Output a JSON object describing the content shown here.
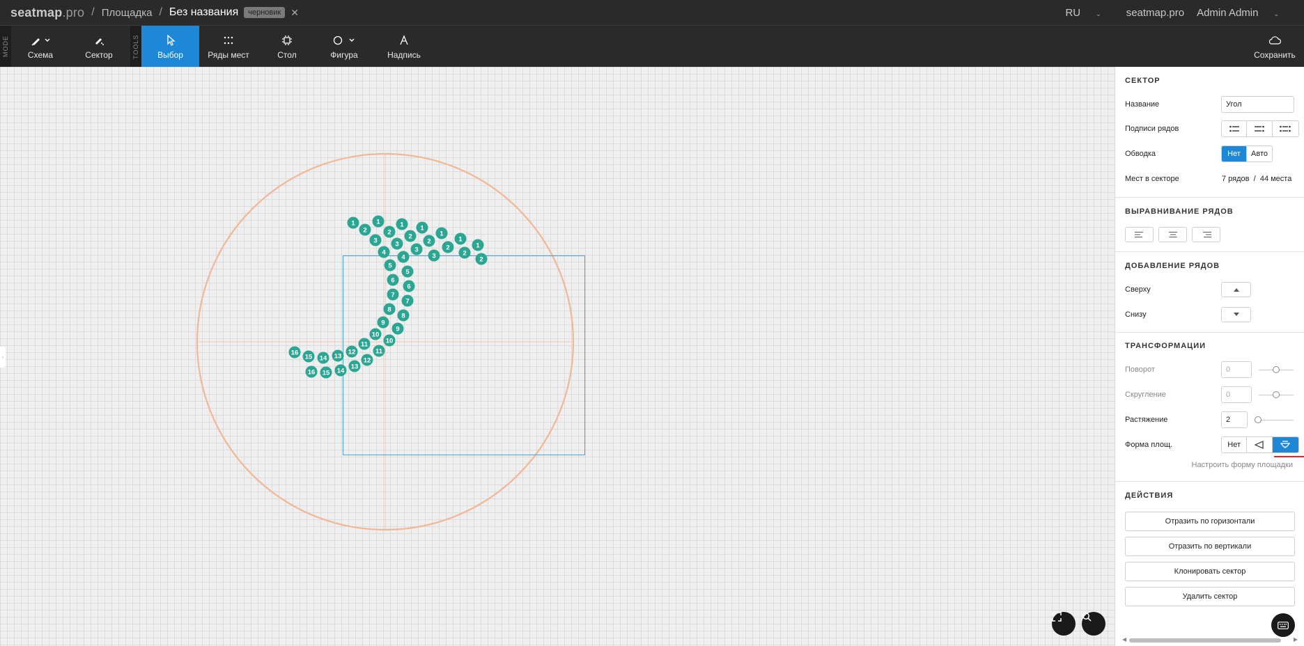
{
  "topbar": {
    "brand_main": "seatmap",
    "brand_suffix": ".pro",
    "breadcrumb": [
      "Площадка",
      "Без названия"
    ],
    "draft_badge": "черновик",
    "lang": "RU",
    "domain": "seatmap.pro",
    "user": "Admin Admin"
  },
  "toolbar": {
    "mode_label": "MODE",
    "tools_label": "TOOLS",
    "schema": "Схема",
    "sector": "Сектор",
    "select": "Выбор",
    "rows": "Ряды мест",
    "table": "Стол",
    "shape": "Фигура",
    "text": "Надпись",
    "save": "Сохранить"
  },
  "seat_map": {
    "seat_color": "#2aa693",
    "guide_color": "#f0b896",
    "selection_color": "#4aa3df",
    "rows": [
      [
        "1",
        "2",
        "3",
        "4",
        "5",
        "6",
        "7",
        "8",
        "9",
        "10",
        "11",
        "12",
        "13",
        "14",
        "15",
        "16"
      ],
      [
        "1",
        "2",
        "3",
        "4",
        "5",
        "6",
        "7",
        "8",
        "9",
        "10",
        "11",
        "12",
        "13",
        "14",
        "15",
        "16"
      ],
      [
        "1",
        "2",
        "3"
      ],
      [
        "1",
        "2",
        "3"
      ],
      [
        "1",
        "2"
      ],
      [
        "1",
        "2"
      ],
      [
        "1",
        "2"
      ]
    ]
  },
  "panel": {
    "sector": {
      "title": "СЕКТОР",
      "name_label": "Название",
      "name_value": "Угол",
      "row_labels_label": "Подписи рядов",
      "outline_label": "Обводка",
      "outline_options": [
        "Нет",
        "Авто"
      ],
      "outline_selected": "Нет",
      "seats_label": "Мест в секторе",
      "rows_count": "7 рядов",
      "seats_count": "44 места",
      "divider": "/"
    },
    "align": {
      "title": "ВЫРАВНИВАНИЕ РЯДОВ"
    },
    "add_rows": {
      "title": "ДОБАВЛЕНИЕ РЯДОВ",
      "top": "Сверху",
      "bottom": "Снизу"
    },
    "transform": {
      "title": "ТРАНСФОРМАЦИИ",
      "rotation_label": "Поворот",
      "rotation_value": "0",
      "rounding_label": "Скругление",
      "rounding_value": "0",
      "stretch_label": "Растяжение",
      "stretch_value": "2",
      "shape_label": "Форма площ.",
      "shape_none": "Нет",
      "shape_link": "Настроить форму площадки"
    },
    "actions": {
      "title": "ДЕЙСТВИЯ",
      "flip_h": "Отразить по горизонтали",
      "flip_v": "Отразить по вертикали",
      "clone": "Клонировать сектор",
      "delete": "Удалить сектор"
    }
  },
  "colors": {
    "accent": "#1e88d6",
    "toolbar_bg": "#2a2a2a",
    "highlight_line": "#e0242a"
  }
}
